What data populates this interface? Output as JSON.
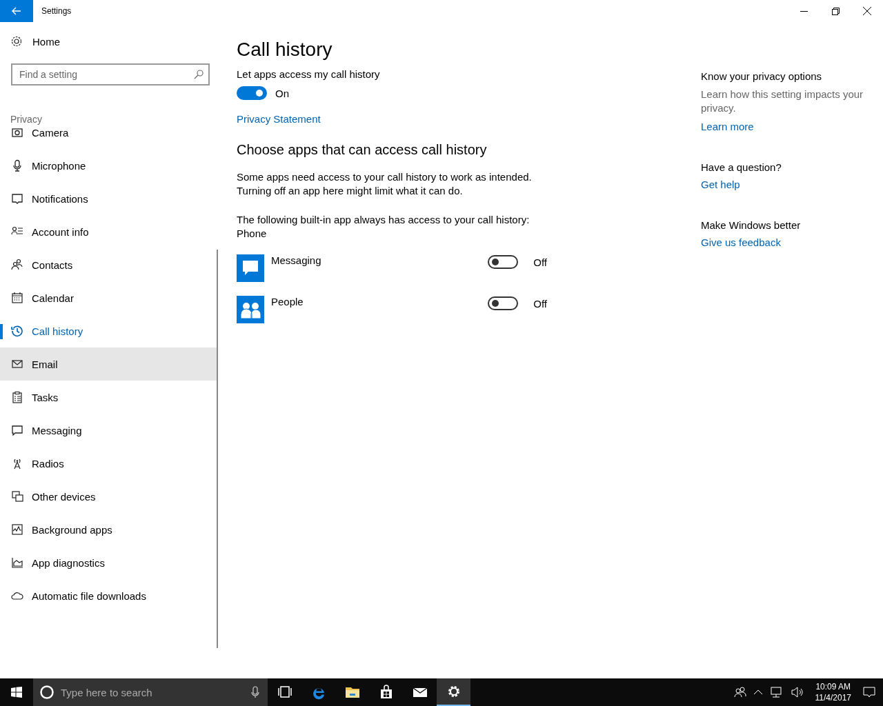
{
  "window": {
    "title": "Settings"
  },
  "sidebar": {
    "home": "Home",
    "search": {
      "placeholder": "Find a setting"
    },
    "section": "Privacy",
    "items": [
      {
        "label": "Camera",
        "selected": false,
        "hovered": false
      },
      {
        "label": "Microphone",
        "selected": false,
        "hovered": false
      },
      {
        "label": "Notifications",
        "selected": false,
        "hovered": false
      },
      {
        "label": "Account info",
        "selected": false,
        "hovered": false
      },
      {
        "label": "Contacts",
        "selected": false,
        "hovered": false
      },
      {
        "label": "Calendar",
        "selected": false,
        "hovered": false
      },
      {
        "label": "Call history",
        "selected": true,
        "hovered": false
      },
      {
        "label": "Email",
        "selected": false,
        "hovered": true
      },
      {
        "label": "Tasks",
        "selected": false,
        "hovered": false
      },
      {
        "label": "Messaging",
        "selected": false,
        "hovered": false
      },
      {
        "label": "Radios",
        "selected": false,
        "hovered": false
      },
      {
        "label": "Other devices",
        "selected": false,
        "hovered": false
      },
      {
        "label": "Background apps",
        "selected": false,
        "hovered": false
      },
      {
        "label": "App diagnostics",
        "selected": false,
        "hovered": false
      },
      {
        "label": "Automatic file downloads",
        "selected": false,
        "hovered": false
      }
    ]
  },
  "main": {
    "title": "Call history",
    "access_label": "Let apps access my call history",
    "access_toggle": {
      "on": true,
      "state_text": "On"
    },
    "privacy_link": "Privacy Statement",
    "apps_heading": "Choose apps that can access call history",
    "description": "Some apps need access to your call history to work as intended. Turning off an app here might limit what it can do.",
    "builtin_note": "The following built-in app always has access to your call history:",
    "builtin_app": "Phone",
    "apps": [
      {
        "kind": "messaging",
        "name": "Messaging",
        "on": false,
        "state_text": "Off"
      },
      {
        "kind": "people",
        "name": "People",
        "on": false,
        "state_text": "Off"
      }
    ]
  },
  "aside": {
    "sections": [
      {
        "heading": "Know your privacy options",
        "text": "Learn how this setting impacts your privacy.",
        "link": "Learn more"
      },
      {
        "heading": "Have a question?",
        "link": "Get help"
      },
      {
        "heading": "Make Windows better",
        "link": "Give us feedback"
      }
    ]
  },
  "taskbar": {
    "search": {
      "placeholder": "Type here to search"
    },
    "pinned": [
      {
        "kind": "task-view",
        "active": false
      },
      {
        "kind": "browser",
        "active": false
      },
      {
        "kind": "folder",
        "active": false
      },
      {
        "kind": "store",
        "active": false
      },
      {
        "kind": "mail",
        "active": false
      },
      {
        "kind": "settings",
        "active": true
      }
    ],
    "time": "10:09 AM",
    "date": "11/4/2017"
  }
}
